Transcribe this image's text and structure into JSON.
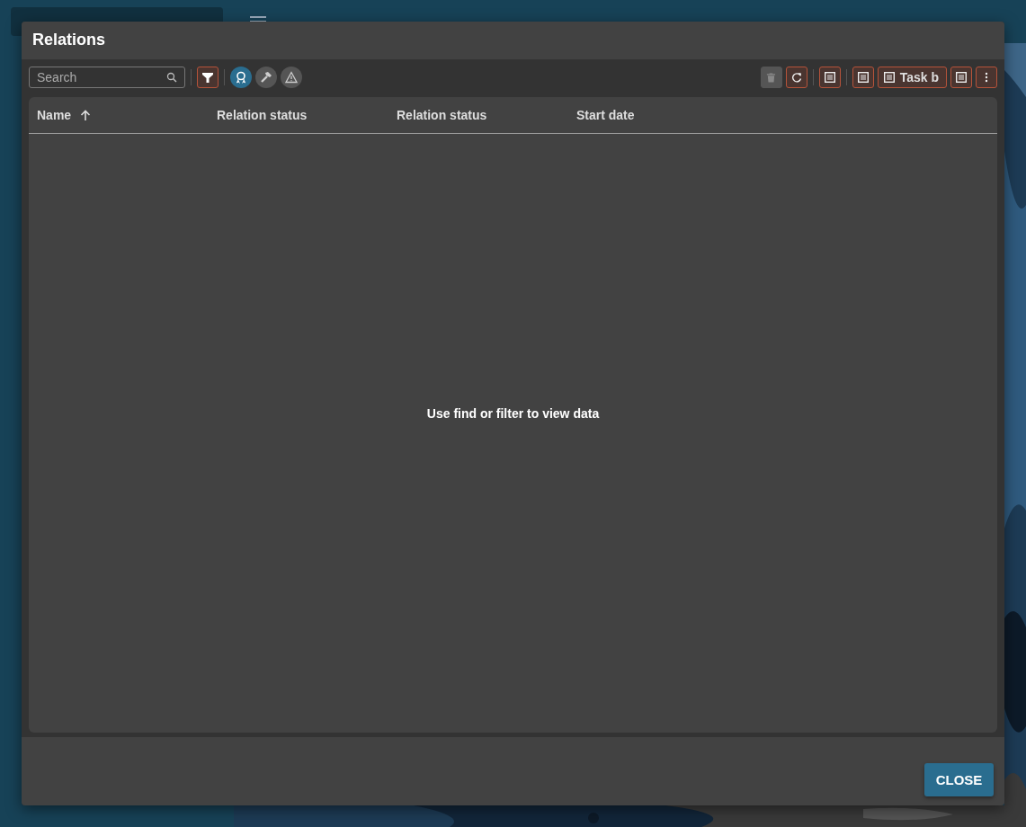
{
  "dialog": {
    "title": "Relations",
    "toolbar": {
      "search": {
        "placeholder": "Search"
      },
      "filter": {
        "active": true
      },
      "toggles": [
        {
          "selected": true
        },
        {
          "selected": false
        },
        {
          "selected": false
        }
      ],
      "delete": {
        "disabled": true
      },
      "task_button": "Task b"
    },
    "columns": [
      {
        "label": "Name",
        "sorted": true
      },
      {
        "label": "Relation status",
        "sorted": false
      },
      {
        "label": "Relation status",
        "sorted": false
      },
      {
        "label": "Start date",
        "sorted": false
      }
    ],
    "empty_message": "Use find or filter to view data",
    "close_button": "CLOSE"
  }
}
